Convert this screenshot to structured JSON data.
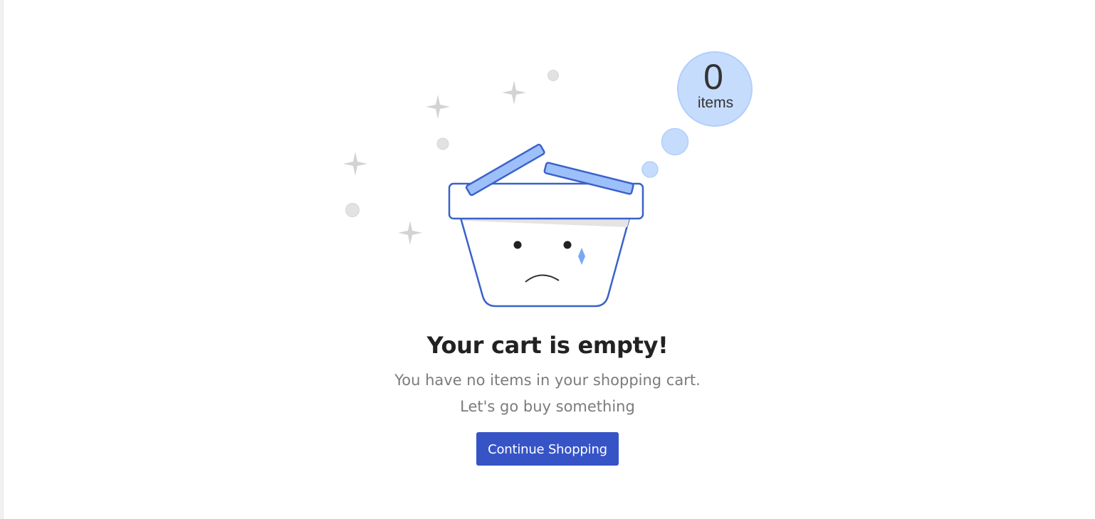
{
  "badge": {
    "count": "0",
    "label": "items"
  },
  "empty_state": {
    "title": "Your cart is empty!",
    "line1": "You have no items in your shopping cart.",
    "line2": "Let's go buy something"
  },
  "actions": {
    "continue_label": "Continue Shopping"
  },
  "colors": {
    "primary": "#3754c7",
    "basket_outline": "#3a62c9",
    "lid_fill": "#9dc0fb",
    "bubble_fill": "#c6dcfd",
    "sparkle": "#d3d3d3",
    "tear": "#7aa8f5"
  },
  "icons": {
    "illustration": "sad-basket-icon",
    "badge": "item-count-bubble-icon"
  }
}
